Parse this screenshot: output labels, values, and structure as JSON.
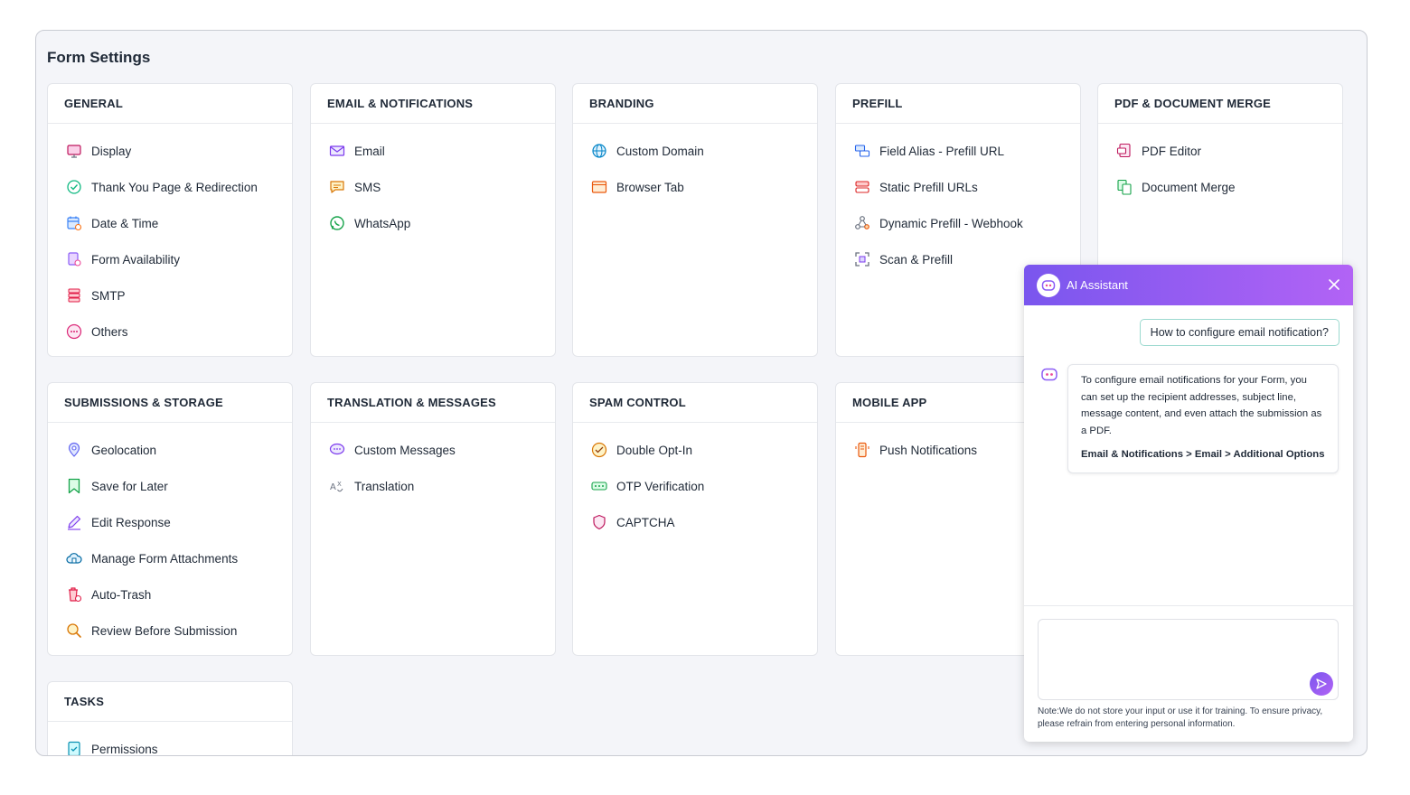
{
  "page": {
    "title": "Form Settings"
  },
  "sections": [
    {
      "title": "GENERAL",
      "items": [
        {
          "label": "Display",
          "icon": "display-icon"
        },
        {
          "label": "Thank You Page & Redirection",
          "icon": "check-circle-icon"
        },
        {
          "label": "Date & Time",
          "icon": "calendar-clock-icon"
        },
        {
          "label": "Form Availability",
          "icon": "form-availability-icon"
        },
        {
          "label": "SMTP",
          "icon": "server-icon"
        },
        {
          "label": "Others",
          "icon": "more-circle-icon"
        }
      ]
    },
    {
      "title": "EMAIL & NOTIFICATIONS",
      "items": [
        {
          "label": "Email",
          "icon": "envelope-icon"
        },
        {
          "label": "SMS",
          "icon": "sms-icon"
        },
        {
          "label": "WhatsApp",
          "icon": "whatsapp-icon"
        }
      ]
    },
    {
      "title": "BRANDING",
      "items": [
        {
          "label": "Custom Domain",
          "icon": "globe-icon"
        },
        {
          "label": "Browser Tab",
          "icon": "browser-tab-icon"
        }
      ]
    },
    {
      "title": "PREFILL",
      "items": [
        {
          "label": "Field Alias - Prefill URL",
          "icon": "field-alias-icon"
        },
        {
          "label": "Static Prefill URLs",
          "icon": "static-prefill-icon"
        },
        {
          "label": "Dynamic Prefill - Webhook",
          "icon": "webhook-icon"
        },
        {
          "label": "Scan & Prefill",
          "icon": "scan-icon"
        }
      ]
    },
    {
      "title": "PDF & DOCUMENT MERGE",
      "items": [
        {
          "label": "PDF Editor",
          "icon": "pdf-icon"
        },
        {
          "label": "Document Merge",
          "icon": "document-merge-icon"
        }
      ]
    },
    {
      "title": "SUBMISSIONS & STORAGE",
      "items": [
        {
          "label": "Geolocation",
          "icon": "location-pin-icon"
        },
        {
          "label": "Save for Later",
          "icon": "bookmark-icon"
        },
        {
          "label": "Edit Response",
          "icon": "pencil-icon"
        },
        {
          "label": "Manage Form Attachments",
          "icon": "cloud-attachment-icon"
        },
        {
          "label": "Auto-Trash",
          "icon": "trash-clock-icon"
        },
        {
          "label": "Review Before Submission",
          "icon": "magnifier-icon"
        }
      ]
    },
    {
      "title": "TRANSLATION & MESSAGES",
      "items": [
        {
          "label": "Custom Messages",
          "icon": "chat-bubble-icon"
        },
        {
          "label": "Translation",
          "icon": "translate-icon"
        }
      ]
    },
    {
      "title": "SPAM CONTROL",
      "items": [
        {
          "label": "Double Opt-In",
          "icon": "double-check-icon"
        },
        {
          "label": "OTP Verification",
          "icon": "otp-icon"
        },
        {
          "label": "CAPTCHA",
          "icon": "shield-icon"
        }
      ]
    },
    {
      "title": "MOBILE APP",
      "items": [
        {
          "label": "Push Notifications",
          "icon": "mobile-notification-icon"
        }
      ]
    },
    {
      "title": "TASKS",
      "items": [
        {
          "label": "Permissions",
          "icon": "permission-doc-icon"
        }
      ]
    }
  ],
  "assistant": {
    "title": "AI Assistant",
    "user_message": "How to configure email notification?",
    "bot_message": "To configure email notifications for your Form, you can set up the recipient addresses, subject line, message content, and even attach the submission as a PDF.",
    "bot_path": "Email & Notifications > Email > Additional Options",
    "input_placeholder": "",
    "note": "Note:We do not store your input or use it for training. To ensure privacy, please refrain from entering personal information."
  },
  "colors": {
    "accent_start": "#7a56ee",
    "accent_end": "#b263f5",
    "user_bubble_border": "#9bd9cf"
  }
}
